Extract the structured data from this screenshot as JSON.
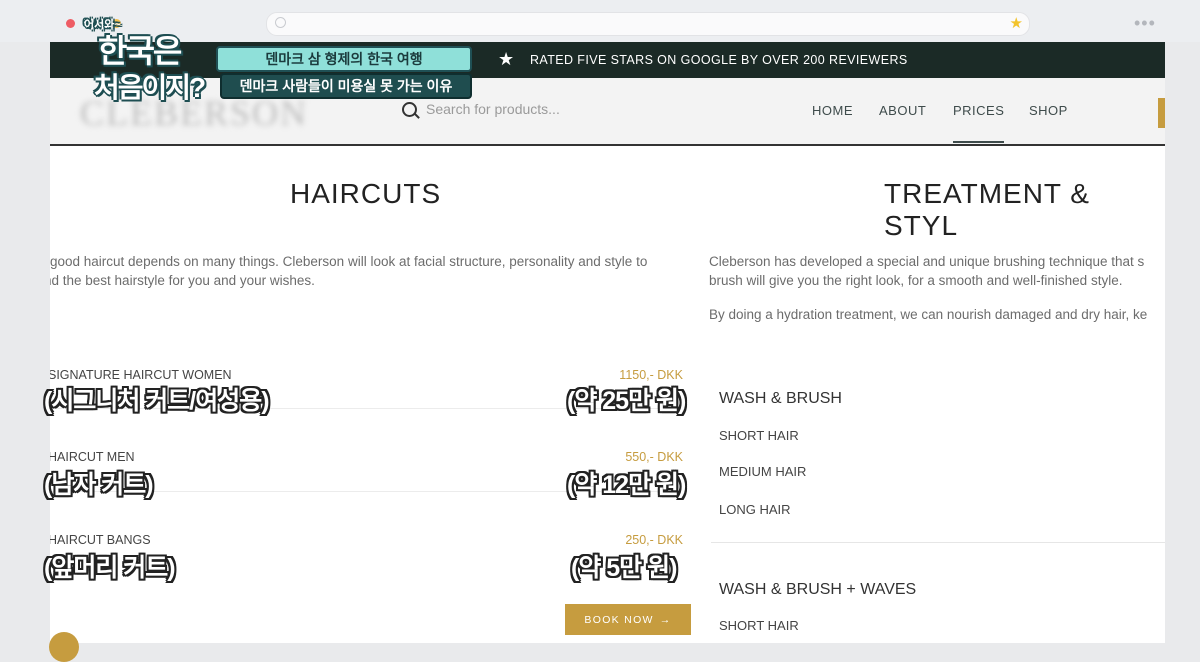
{
  "browser": {
    "address": ""
  },
  "topbar": {
    "message": "RATED FIVE STARS ON GOOGLE BY OVER 200 REVIEWERS"
  },
  "nav": {
    "search_placeholder": "Search for products...",
    "links": [
      "HOME",
      "ABOUT",
      "PRICES",
      "SHOP"
    ],
    "active": "PRICES"
  },
  "haircuts": {
    "title": "HAIRCUTS",
    "description_line1": "good haircut depends on many things. Cleberson will look at facial structure, personality and style to",
    "description_line2": "nd the best hairstyle for you and your wishes.",
    "services": [
      {
        "name": "SIGNATURE HAIRCUT WOMEN",
        "price": "1150,- DKK",
        "subtitle_name": "(시그니처 커트/여성용)",
        "subtitle_price": "(약 25만 원)"
      },
      {
        "name": "HAIRCUT MEN",
        "price": "550,- DKK",
        "subtitle_name": "(남자 커트)",
        "subtitle_price": "(약 12만 원)"
      },
      {
        "name": "HAIRCUT BANGS",
        "price": "250,- DKK",
        "subtitle_name": "(앞머리 커트)",
        "subtitle_price": "(약 5만 원)"
      }
    ],
    "book_label": "BOOK NOW",
    "book_arrow": "→"
  },
  "treatment": {
    "title": "TREATMENT & STYL",
    "description_line1": "Cleberson has developed a special and unique brushing technique that s",
    "description_line2": "brush will give you the right look, for a smooth and well-finished style.",
    "description_line3": "By doing a hydration treatment, we can nourish damaged and dry hair, ke",
    "groups": [
      {
        "heading": "WASH & BRUSH",
        "items": [
          "SHORT HAIR",
          "MEDIUM HAIR",
          "LONG HAIR"
        ]
      },
      {
        "heading": "WASH & BRUSH + WAVES",
        "items": [
          "SHORT HAIR"
        ]
      }
    ]
  },
  "overlay": {
    "logo_small": "어서와~",
    "logo_line1": "한국은",
    "logo_line2": "처음이지?",
    "banner_top": "덴마크 삼 형제의 한국 여행",
    "banner_bottom": "덴마크 사람들이 미용실 못 가는 이유"
  },
  "colors": {
    "accent": "#c69c3f",
    "topbar": "#1b2a26",
    "banner": "#8fe0d9"
  }
}
